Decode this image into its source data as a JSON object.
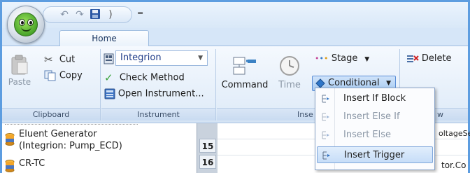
{
  "app": {
    "quick_access": {
      "more": "="
    },
    "tabs": [
      {
        "label": "Home"
      }
    ]
  },
  "ribbon": {
    "clipboard": {
      "paste": "Paste",
      "cut": "Cut",
      "copy": "Copy",
      "label": "Clipboard"
    },
    "instrument": {
      "selected": "Integrion",
      "check_method": "Check Method",
      "open_instrument": "Open Instrument...",
      "label": "Instrument"
    },
    "insert": {
      "command": "Command",
      "time": "Time",
      "stage": "Stage",
      "conditional": "Conditional",
      "label": "Inse"
    },
    "edit": {
      "delete": "Delete",
      "label": "w"
    }
  },
  "conditional_menu": {
    "items": [
      {
        "label": "Insert If Block",
        "enabled": true
      },
      {
        "label": "Insert Else If",
        "enabled": false
      },
      {
        "label": "Insert Else",
        "enabled": false
      },
      {
        "label": "Insert Trigger",
        "enabled": true,
        "highlighted": true
      }
    ]
  },
  "tree": {
    "items": [
      {
        "line1": "Eluent Generator",
        "line2": "(Integrion: Pump_ECD)"
      },
      {
        "line1": "CR-TC"
      }
    ]
  },
  "grid": {
    "row_numbers": [
      "15",
      "16"
    ],
    "cut_texts": [
      "oltageSe",
      "tor.Co"
    ]
  },
  "colors": {
    "accent": "#4f86c6",
    "ribbon_bg": "#e2edf9",
    "highlight": "#c6ddf8"
  }
}
